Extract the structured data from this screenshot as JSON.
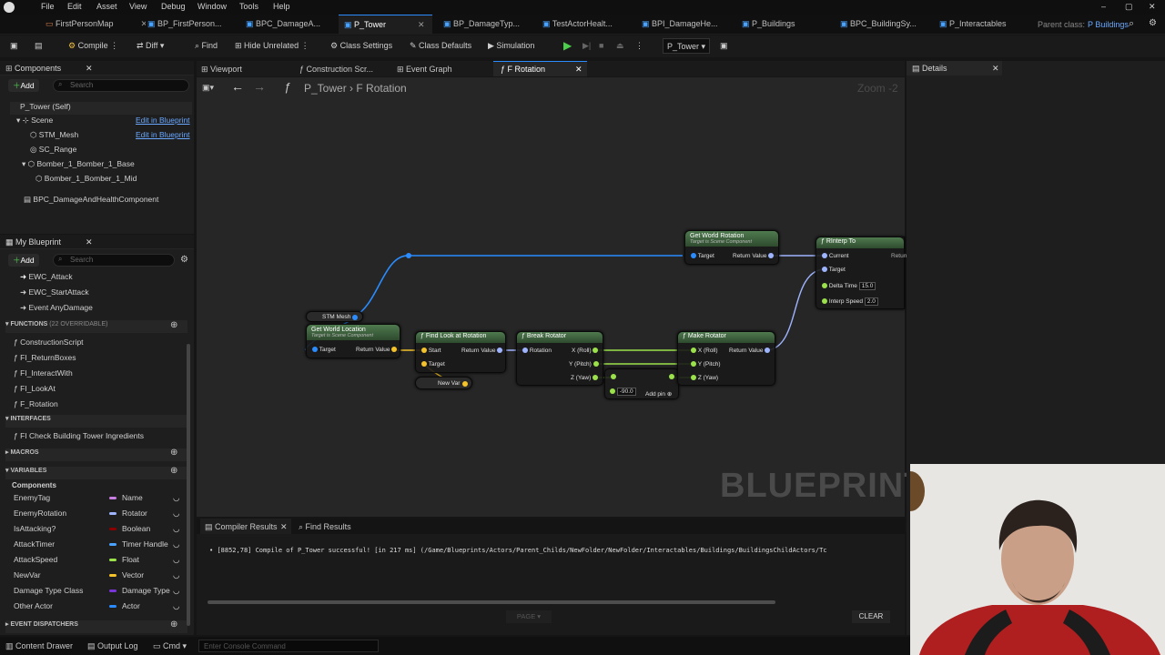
{
  "menu": {
    "edit": "Edit",
    "file": "File",
    "asset": "Asset",
    "view": "View",
    "debug": "Debug",
    "window": "Window",
    "tools": "Tools",
    "help": "Help"
  },
  "tabs": [
    "FirstPersonMap",
    "BP_FirstPerson...",
    "BPC_DamageA...",
    "P_Tower",
    "BP_DamageTyp...",
    "TestActorHealt...",
    "BPI_DamageHe...",
    "P_Buildings",
    "BPC_BuildingSy...",
    "P_Interactables"
  ],
  "parent_class": {
    "label": "Parent class:",
    "value": "P Buildings"
  },
  "toolbar": {
    "compile": "Compile",
    "diff": "Diff",
    "find": "Find",
    "hide_unrelated": "Hide Unrelated",
    "class_settings": "Class Settings",
    "class_defaults": "Class Defaults",
    "simulation": "Simulation",
    "debug_target": "P_Tower"
  },
  "components": {
    "title": "Components",
    "add": "Add",
    "search_placeholder": "Search",
    "items": [
      "P_Tower (Self)",
      "Scene",
      "STM_Mesh",
      "SC_Range",
      "Bomber_1_Bomber_1_Base",
      "Bomber_1_Bomber_1_Mid",
      "BPC_DamageAndHealthComponent"
    ],
    "edit_link": "Edit in Blueprint"
  },
  "my_blueprint": {
    "title": "My Blueprint",
    "add": "Add",
    "search_placeholder": "Search",
    "events": [
      "EWC_Attack",
      "EWC_StartAttack",
      "Event AnyDamage"
    ],
    "functions_label": "FUNCTIONS",
    "functions_count": "(22 OVERRIDABLE)",
    "functions": [
      "ConstructionScript",
      "FI_ReturnBoxes",
      "FI_InteractWith",
      "FI_LookAt",
      "F_Rotation"
    ],
    "interfaces_label": "INTERFACES",
    "interfaces": [
      "FI Check Building Tower Ingredients"
    ],
    "macros_label": "MACROS",
    "variables_label": "VARIABLES",
    "components_label": "Components",
    "variables": [
      {
        "name": "EnemyTag",
        "type": "Name",
        "color": "#c77ee0"
      },
      {
        "name": "EnemyRotation",
        "type": "Rotator",
        "color": "#9fb4ff"
      },
      {
        "name": "IsAttacking?",
        "type": "Boolean",
        "color": "#8b0000"
      },
      {
        "name": "AttackTimer",
        "type": "Timer Handle",
        "color": "#4aa3ff"
      },
      {
        "name": "AttackSpeed",
        "type": "Float",
        "color": "#9be24a"
      },
      {
        "name": "NewVar",
        "type": "Vector",
        "color": "#f4c22a"
      },
      {
        "name": "Damage Type Class",
        "type": "Damage Type",
        "color": "#7a35d8"
      },
      {
        "name": "Other Actor",
        "type": "Actor",
        "color": "#2a8cff"
      }
    ],
    "dispatchers_label": "EVENT DISPATCHERS"
  },
  "graph_tabs": [
    "Viewport",
    "Construction Scr...",
    "Event Graph",
    "F Rotation"
  ],
  "breadcrumb": {
    "root": "P_Tower",
    "leaf": "F Rotation"
  },
  "zoom": "Zoom -2",
  "watermark": "BLUEPRINT",
  "nodes": {
    "get_world_rotation": {
      "title": "Get World Rotation",
      "sub": "Target is Scene Component",
      "target": "Target",
      "ret": "Return Value"
    },
    "rinterp": {
      "title": "RInterp To",
      "current": "Current",
      "target": "Target",
      "ret": "Return",
      "delta": "Delta Time",
      "delta_val": "15.0",
      "speed": "Interp Speed",
      "speed_val": "2.0"
    },
    "stm_mesh": "STM Mesh",
    "get_world_location": {
      "title": "Get World Location",
      "sub": "Target is Scene Component",
      "target": "Target",
      "ret": "Return Value"
    },
    "find_look": {
      "title": "Find Look at Rotation",
      "start": "Start",
      "target": "Target",
      "ret": "Return Value"
    },
    "new_var": "New Var",
    "break_rot": {
      "title": "Break Rotator",
      "rotation": "Rotation",
      "x": "X (Roll)",
      "y": "Y (Pitch)",
      "z": "Z (Yaw)"
    },
    "add": {
      "value": "-90.0",
      "add_pin": "Add pin"
    },
    "make_rot": {
      "title": "Make Rotator",
      "x": "X (Roll)",
      "y": "Y (Pitch)",
      "z": "Z (Yaw)",
      "ret": "Return Value"
    }
  },
  "details_title": "Details",
  "compiler": {
    "tab": "Compiler Results",
    "find_tab": "Find Results",
    "message": "[8852,78] Compile of P_Tower successful! [in 217 ms] (/Game/Blueprints/Actors/Parent_Childs/NewFolder/NewFolder/Interactables/Buildings/BuildingsChildActors/Tc",
    "page": "PAGE",
    "clear": "CLEAR"
  },
  "statusbar": {
    "content_drawer": "Content Drawer",
    "output_log": "Output Log",
    "cmd": "Cmd",
    "console_placeholder": "Enter Console Command"
  },
  "colors": {
    "accent": "#2a8cff",
    "pure_node": "#3b6b3b",
    "exec": "#ffffff"
  }
}
